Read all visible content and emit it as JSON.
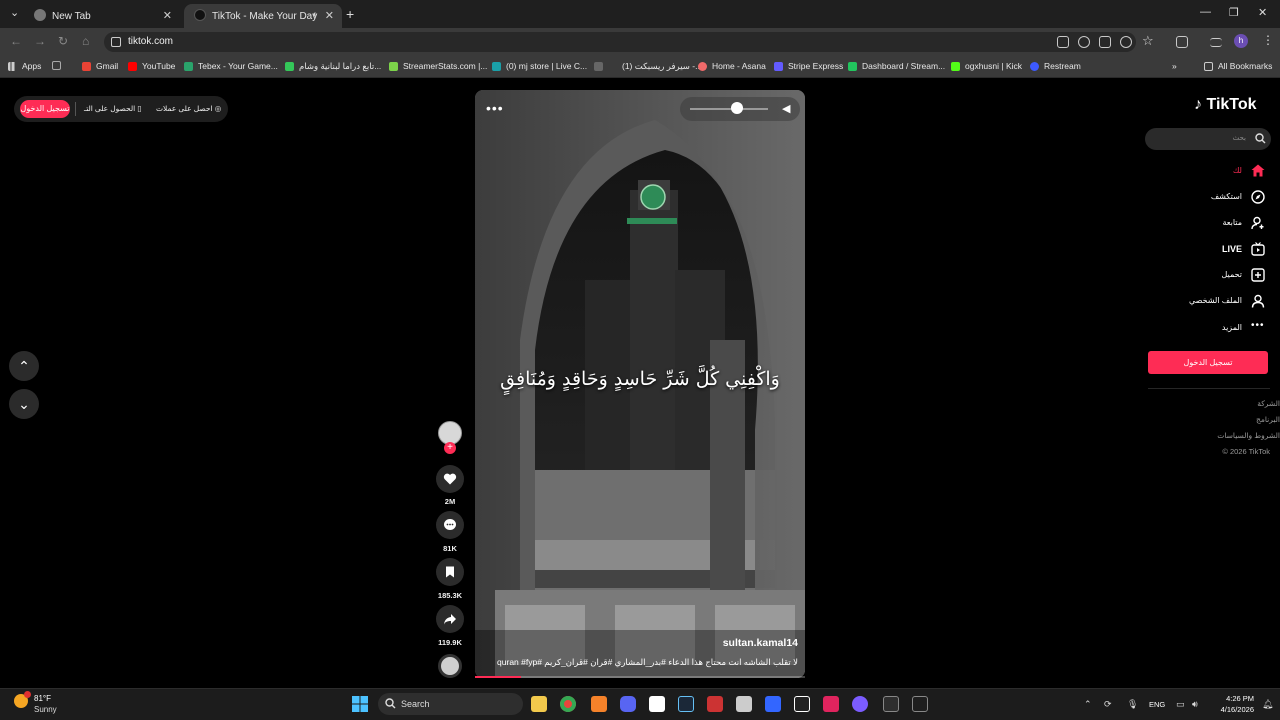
{
  "browser": {
    "tabs": [
      {
        "title": "New Tab"
      },
      {
        "title": "TikTok - Make Your Day"
      }
    ],
    "url": "tiktok.com",
    "profile_initial": "h",
    "bookmarks": [
      {
        "label": "Apps"
      },
      {
        "label": "Gmail"
      },
      {
        "label": "YouTube"
      },
      {
        "label": "Tebex - Your Game..."
      },
      {
        "label": "تابع دراما لبنانية وشام..."
      },
      {
        "label": "StreamerStats.com |..."
      },
      {
        "label": "(0) mj store | Live C..."
      },
      {
        "label": "(1) سيرفر ريسبكت -..."
      },
      {
        "label": "Home - Asana"
      },
      {
        "label": "Stripe Express"
      },
      {
        "label": "Dashboard / Stream..."
      },
      {
        "label": "ogxhusni | Kick"
      },
      {
        "label": "Restream"
      }
    ],
    "all_bookmarks": "All Bookmarks"
  },
  "topbar": {
    "login": "تسجيل الدخول",
    "get_app": "الحصول على التـ",
    "get_coins": "احصل على عملات"
  },
  "video": {
    "verse": "وَاكْفِنِي كُلَّ شَرِّ حَاسِدٍ وَحَاقِدٍ وَمُنَافِقٍ",
    "username": "sultan.kamal14",
    "caption": "لا تقلب الشاشه انت محتاج هذا الدعاء #بدر_المشاري #قران #قران_كريم #quran #fyp",
    "progress": 0.14,
    "volume": 0.6
  },
  "actions": {
    "likes": "2M",
    "comments": "81K",
    "saves": "185.3K",
    "shares": "119.9K"
  },
  "sidebar": {
    "logo": "TikTok",
    "search_placeholder": "بحث",
    "nav": [
      {
        "label": "لك",
        "icon": "home-icon"
      },
      {
        "label": "استكشف",
        "icon": "compass-icon"
      },
      {
        "label": "متابعة",
        "icon": "user-plus-icon"
      },
      {
        "label": "LIVE",
        "icon": "live-icon"
      },
      {
        "label": "تحميل",
        "icon": "upload-icon"
      },
      {
        "label": "الملف الشخصي",
        "icon": "profile-icon"
      },
      {
        "label": "المزيد",
        "icon": "more-icon"
      }
    ],
    "login": "تسجيل الدخول",
    "footer": [
      "الشركة",
      "البرنامج",
      "الشروط والسياسات",
      "© 2026 TikTok"
    ]
  },
  "taskbar": {
    "temp": "81°F",
    "weather": "Sunny",
    "search": "Search",
    "lang": "ENG",
    "time": "4:26 PM",
    "date": "4/16/2026"
  },
  "colors": {
    "accent": "#fe2c55",
    "page_bg": "#000000",
    "chrome_bg": "#3a3a3a"
  }
}
